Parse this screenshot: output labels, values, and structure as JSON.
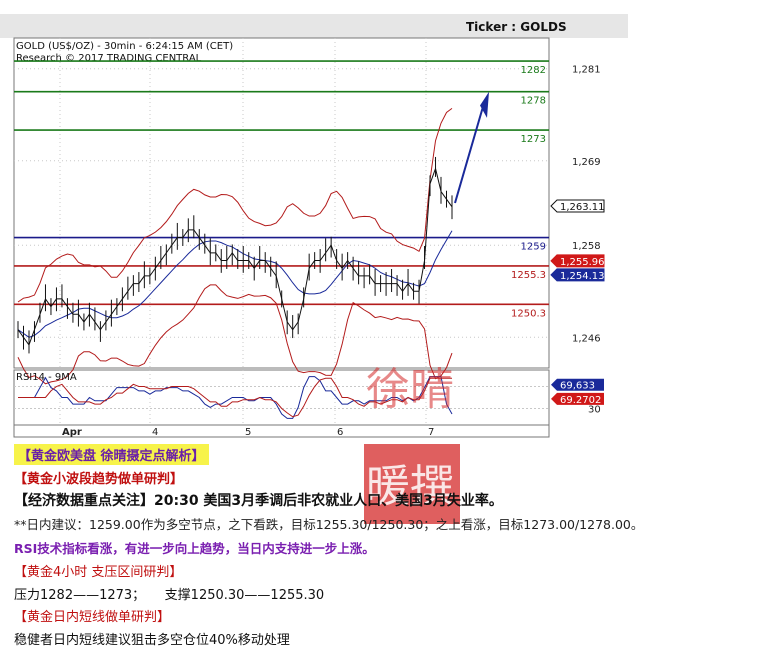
{
  "header": {
    "ticker": "Ticker : GOLDS"
  },
  "chart_data": {
    "type": "line",
    "title": "GOLD (US$/OZ) - 30min - 6:24:15 AM (CET)",
    "subtitle": "Research © 2017 TRADING CENTRAL",
    "ylim": [
      1242,
      1285
    ],
    "y_ticks": [
      "1,281",
      "1,269",
      "1,258",
      "1,246"
    ],
    "y_tick_values": [
      1281,
      1269,
      1258,
      1246
    ],
    "x_ticks": [
      "Apr",
      "4",
      "5",
      "6",
      "7"
    ],
    "levels": [
      {
        "value": 1282,
        "label": "1282",
        "color": "#1a7a1a"
      },
      {
        "value": 1278,
        "label": "1278",
        "color": "#1a7a1a"
      },
      {
        "value": 1273,
        "label": "1273",
        "color": "#1a7a1a"
      },
      {
        "value": 1259,
        "label": "1259",
        "color": "#1a1a8a"
      },
      {
        "value": 1255.3,
        "label": "1255.3",
        "color": "#b31b1b"
      },
      {
        "value": 1250.3,
        "label": "1250.3",
        "color": "#b31b1b"
      }
    ],
    "price_tags": [
      {
        "value": 1263.11,
        "label": "1,263.11",
        "color": "#111111"
      },
      {
        "value": 1255.96,
        "label": "1,255.96",
        "color": "#d01818"
      },
      {
        "value": 1254.13,
        "label": "1,254.13",
        "color": "#1a2a9a"
      }
    ],
    "price_series": [
      1247,
      1246,
      1245,
      1247,
      1249,
      1251,
      1250,
      1251,
      1251,
      1250,
      1249,
      1249,
      1248,
      1249,
      1248,
      1247,
      1248,
      1249,
      1250,
      1251,
      1252,
      1253,
      1253,
      1254,
      1254,
      1255,
      1256,
      1257,
      1258,
      1259,
      1259,
      1260,
      1260,
      1259,
      1258,
      1257,
      1257,
      1256,
      1256,
      1257,
      1256,
      1256,
      1256,
      1255,
      1256,
      1256,
      1255,
      1254,
      1251,
      1248,
      1247,
      1248,
      1251,
      1255,
      1256,
      1256,
      1257,
      1258,
      1256,
      1255,
      1256,
      1255,
      1254,
      1254,
      1254,
      1253,
      1253,
      1253,
      1253,
      1253,
      1252,
      1253,
      1252,
      1252,
      1256,
      1266,
      1268,
      1265,
      1264,
      1263
    ],
    "rsi": {
      "label": "RSI14 - 9MA",
      "ticks": [
        "70",
        "30"
      ],
      "tags": [
        {
          "value": 69.633,
          "label": "69,633",
          "color": "#1a2a9a"
        },
        {
          "value": 69.2702,
          "label": "69.2702",
          "color": "#d01818"
        }
      ],
      "ylim": [
        0,
        100
      ]
    }
  },
  "text": {
    "line1": "【黄金欧美盘 徐晴摄定点解析】",
    "line2": "【黄金小波段趋势做单研判】",
    "line3": "【经济数据重点关注】20:30 美国3月季调后非农就业人口、美国3月失业率。",
    "line4": "**日内建议：1259.00作为多空节点，之下看跌，目标1255.30/1250.30；之上看涨，目标1273.00/1278.00。",
    "line5": "RSI技术指标看涨，有进一步向上趋势，当日内支持进一步上涨。",
    "line6": "【黄金4小时 支压区间研判】",
    "line7": "压力1282——1273；　　支撑1250.30——1255.30",
    "line8": "【黄金日内短线做单研判】",
    "line9": "稳健者日内短线建议狙击多空仓位40%移动处理"
  },
  "stamp": {
    "text": "徐晴暖撰",
    "color": "#d42a2a"
  }
}
